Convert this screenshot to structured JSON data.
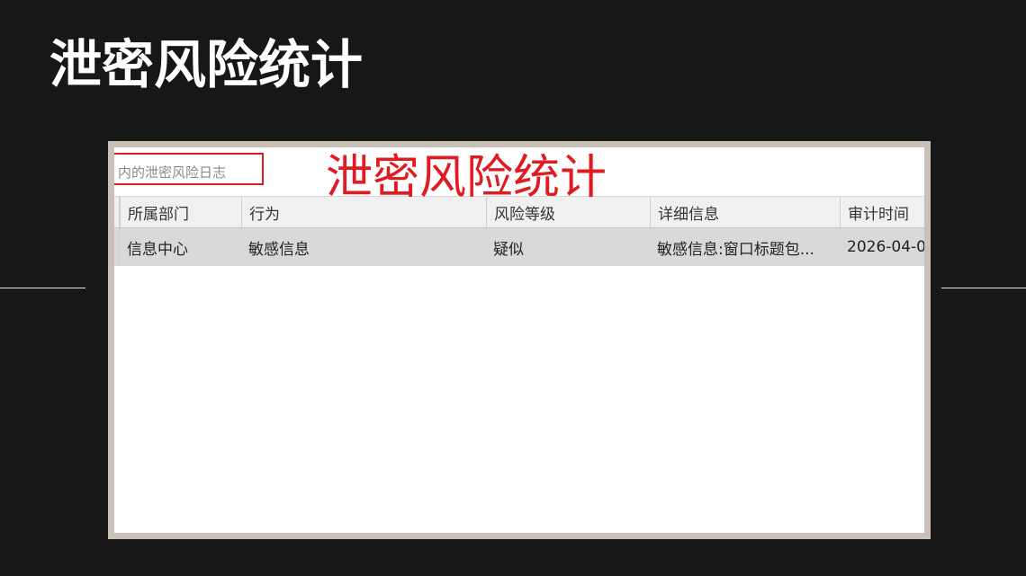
{
  "slide": {
    "title": "泄密风险统计"
  },
  "screenshot": {
    "log_tab_label": "内的泄密风险日志",
    "overlay_caption": "泄密风险统计",
    "table": {
      "columns": [
        "所属部门",
        "行为",
        "风险等级",
        "详细信息",
        "审计时间"
      ],
      "rows": [
        [
          "信息中心",
          "敏感信息",
          "疑似",
          "敏感信息:窗口标题包...",
          "2026-04-0"
        ]
      ]
    }
  },
  "colors": {
    "background": "#171717",
    "accent_red": "#e11b22",
    "selected_row": "#d9d9d9"
  }
}
